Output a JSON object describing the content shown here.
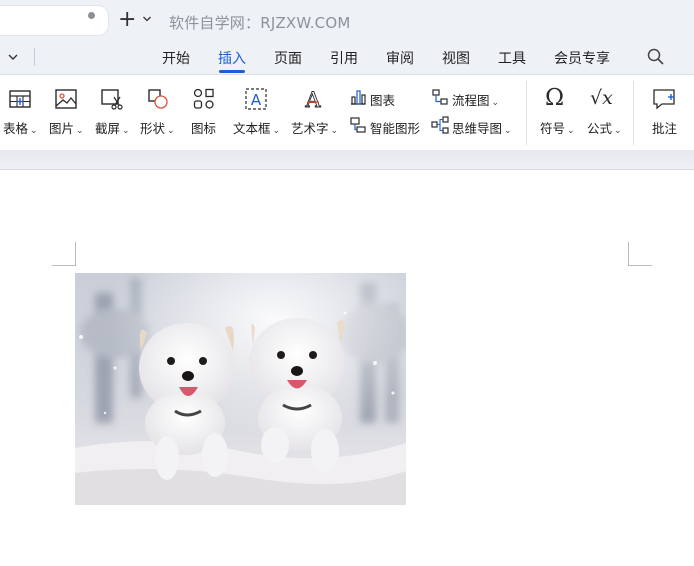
{
  "titlebar": {
    "watermark": "软件自学网：RJZXW.COM",
    "new_tab_symbol": "+"
  },
  "menu": {
    "items": [
      "开始",
      "插入",
      "页面",
      "引用",
      "审阅",
      "视图",
      "工具",
      "会员专享"
    ],
    "active": "插入"
  },
  "ribbon": {
    "table": "表格",
    "picture": "图片",
    "screenshot": "截屏",
    "shapes": "形状",
    "icons": "图标",
    "textbox": "文本框",
    "wordart": "艺术字",
    "chart": "图表",
    "smartart": "智能图形",
    "flowchart": "流程图",
    "mindmap": "思维导图",
    "symbol": "符号",
    "formula": "公式",
    "comment": "批注",
    "symbol_glyph": "Ω",
    "formula_glyph": "√x",
    "textbox_glyph": "A",
    "wordart_glyph": "A"
  },
  "document": {
    "image_subject": "two white puppies running in snow"
  },
  "colors": {
    "accent": "#1f5fd6",
    "chrome": "#eef1f5"
  }
}
